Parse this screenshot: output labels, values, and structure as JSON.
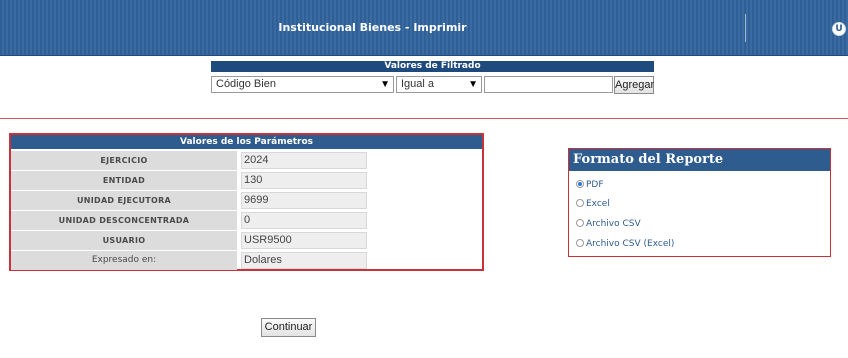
{
  "header": {
    "title": "Institucional Bienes - Imprimir",
    "logo_text": "U"
  },
  "filter": {
    "title": "Valores de Filtrado",
    "field_select": "Código Bien",
    "operator_select": "Igual a",
    "value_input": "",
    "add_button": "Agregar"
  },
  "params": {
    "title": "Valores de los Parámetros",
    "rows": [
      {
        "label": "EJERCICIO",
        "value": "2024"
      },
      {
        "label": "ENTIDAD",
        "value": "130"
      },
      {
        "label": "UNIDAD EJECUTORA",
        "value": "9699"
      },
      {
        "label": "UNIDAD DESCONCENTRADA",
        "value": "0"
      },
      {
        "label": "USUARIO",
        "value": "USR9500"
      },
      {
        "label": "Expresado en:",
        "value": "Dolares"
      }
    ]
  },
  "report_format": {
    "title": "Formato del Reporte",
    "options": [
      {
        "label": "PDF",
        "selected": true
      },
      {
        "label": "Excel",
        "selected": false
      },
      {
        "label": "Archivo CSV",
        "selected": false
      },
      {
        "label": "Archivo CSV (Excel)",
        "selected": false
      }
    ]
  },
  "actions": {
    "continue_button": "Continuar"
  },
  "colors": {
    "banner": "#2f5f95",
    "panel_header": "#2e5c8f",
    "panel_border": "#c8323a",
    "label_bg": "#dcdcdc"
  }
}
